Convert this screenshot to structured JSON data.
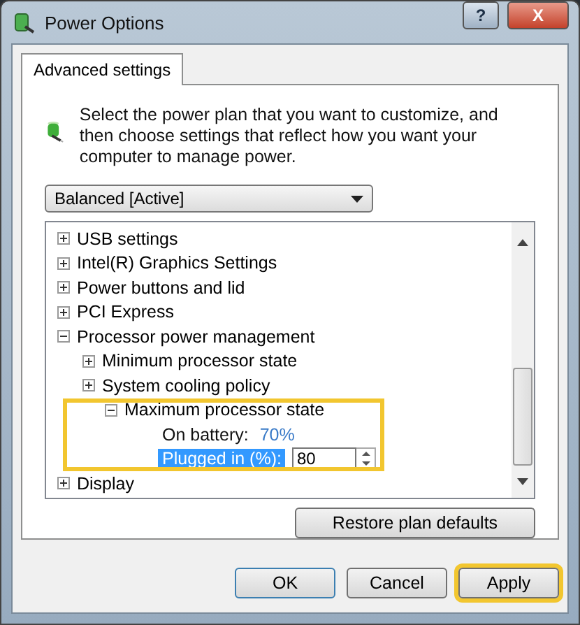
{
  "window": {
    "title": "Power Options",
    "buttons": [
      {
        "kind": "help",
        "label": "?"
      },
      {
        "kind": "close",
        "label": "X"
      }
    ]
  },
  "tabs": [
    {
      "label": "Advanced settings",
      "selected": true
    }
  ],
  "description": "Select the power plan that you want to customize, and then choose settings that reflect how you want your computer to manage power.",
  "plan": {
    "value": "Balanced [Active]"
  },
  "tree": [
    {
      "label": "USB settings",
      "expanded": false
    },
    {
      "label": "Intel(R) Graphics Settings",
      "expanded": false
    },
    {
      "label": "Power buttons and lid",
      "expanded": false
    },
    {
      "label": "PCI Express",
      "expanded": false
    },
    {
      "label": "Processor power management",
      "expanded": true,
      "children": [
        {
          "label": "Minimum processor state",
          "expanded": false
        },
        {
          "label": "System cooling policy",
          "expanded": false
        },
        {
          "label": "Maximum processor state",
          "expanded": true,
          "highlighted": true,
          "settings": [
            {
              "kind": "value",
              "label": "On battery:",
              "value": "70%",
              "selected": false
            },
            {
              "kind": "spin",
              "label": "Plugged in (%):",
              "value": "80",
              "selected": true
            }
          ]
        }
      ]
    },
    {
      "label": "Display",
      "expanded": false
    }
  ],
  "restore_button": "Restore plan defaults",
  "buttons": [
    {
      "label": "OK",
      "default": true,
      "highlighted": false
    },
    {
      "label": "Cancel",
      "default": false,
      "highlighted": false
    },
    {
      "label": "Apply",
      "default": false,
      "highlighted": true
    }
  ]
}
